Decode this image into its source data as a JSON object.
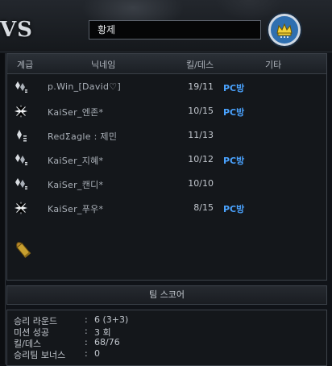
{
  "banner": {
    "team_letters": "VS",
    "player_name": "황제",
    "emblem_icon": "clan-crown-emblem-icon"
  },
  "table": {
    "headers": {
      "rank": "계급",
      "nickname": "닉네임",
      "kill_death": "킬/데스",
      "other": "기타"
    },
    "rows": [
      {
        "rank_icon": "diamond-rank-icon",
        "nickname": "p.Win_[David♡]",
        "kd": "19/11",
        "other": "PC방"
      },
      {
        "rank_icon": "star-burst-rank-icon",
        "nickname": "KaiSer_엔존*",
        "kd": "10/15",
        "other": "PC방"
      },
      {
        "rank_icon": "diamond-bars-rank-icon",
        "nickname": "RedΣagle : 제민",
        "kd": "11/13",
        "other": ""
      },
      {
        "rank_icon": "diamond-rank-icon",
        "nickname": "KaiSer_지혜*",
        "kd": "10/12",
        "other": "PC방"
      },
      {
        "rank_icon": "diamond-rank-icon",
        "nickname": "KaiSer_캔디*",
        "kd": "10/10",
        "other": ""
      },
      {
        "rank_icon": "star-burst-rank-icon",
        "nickname": "KaiSer_푸우*",
        "kd": "8/15",
        "other": "PC방"
      }
    ],
    "pc_color": "#4aa3ff"
  },
  "team_score": {
    "title": "팀 스코어"
  },
  "stats": [
    {
      "label": "승리 라운드",
      "value": "6 (3+3)"
    },
    {
      "label": "미션 성공",
      "value": "3 회"
    },
    {
      "label": "킬/데스",
      "value": "68/76"
    },
    {
      "label": "승리팀 보너스",
      "value": "0"
    }
  ]
}
